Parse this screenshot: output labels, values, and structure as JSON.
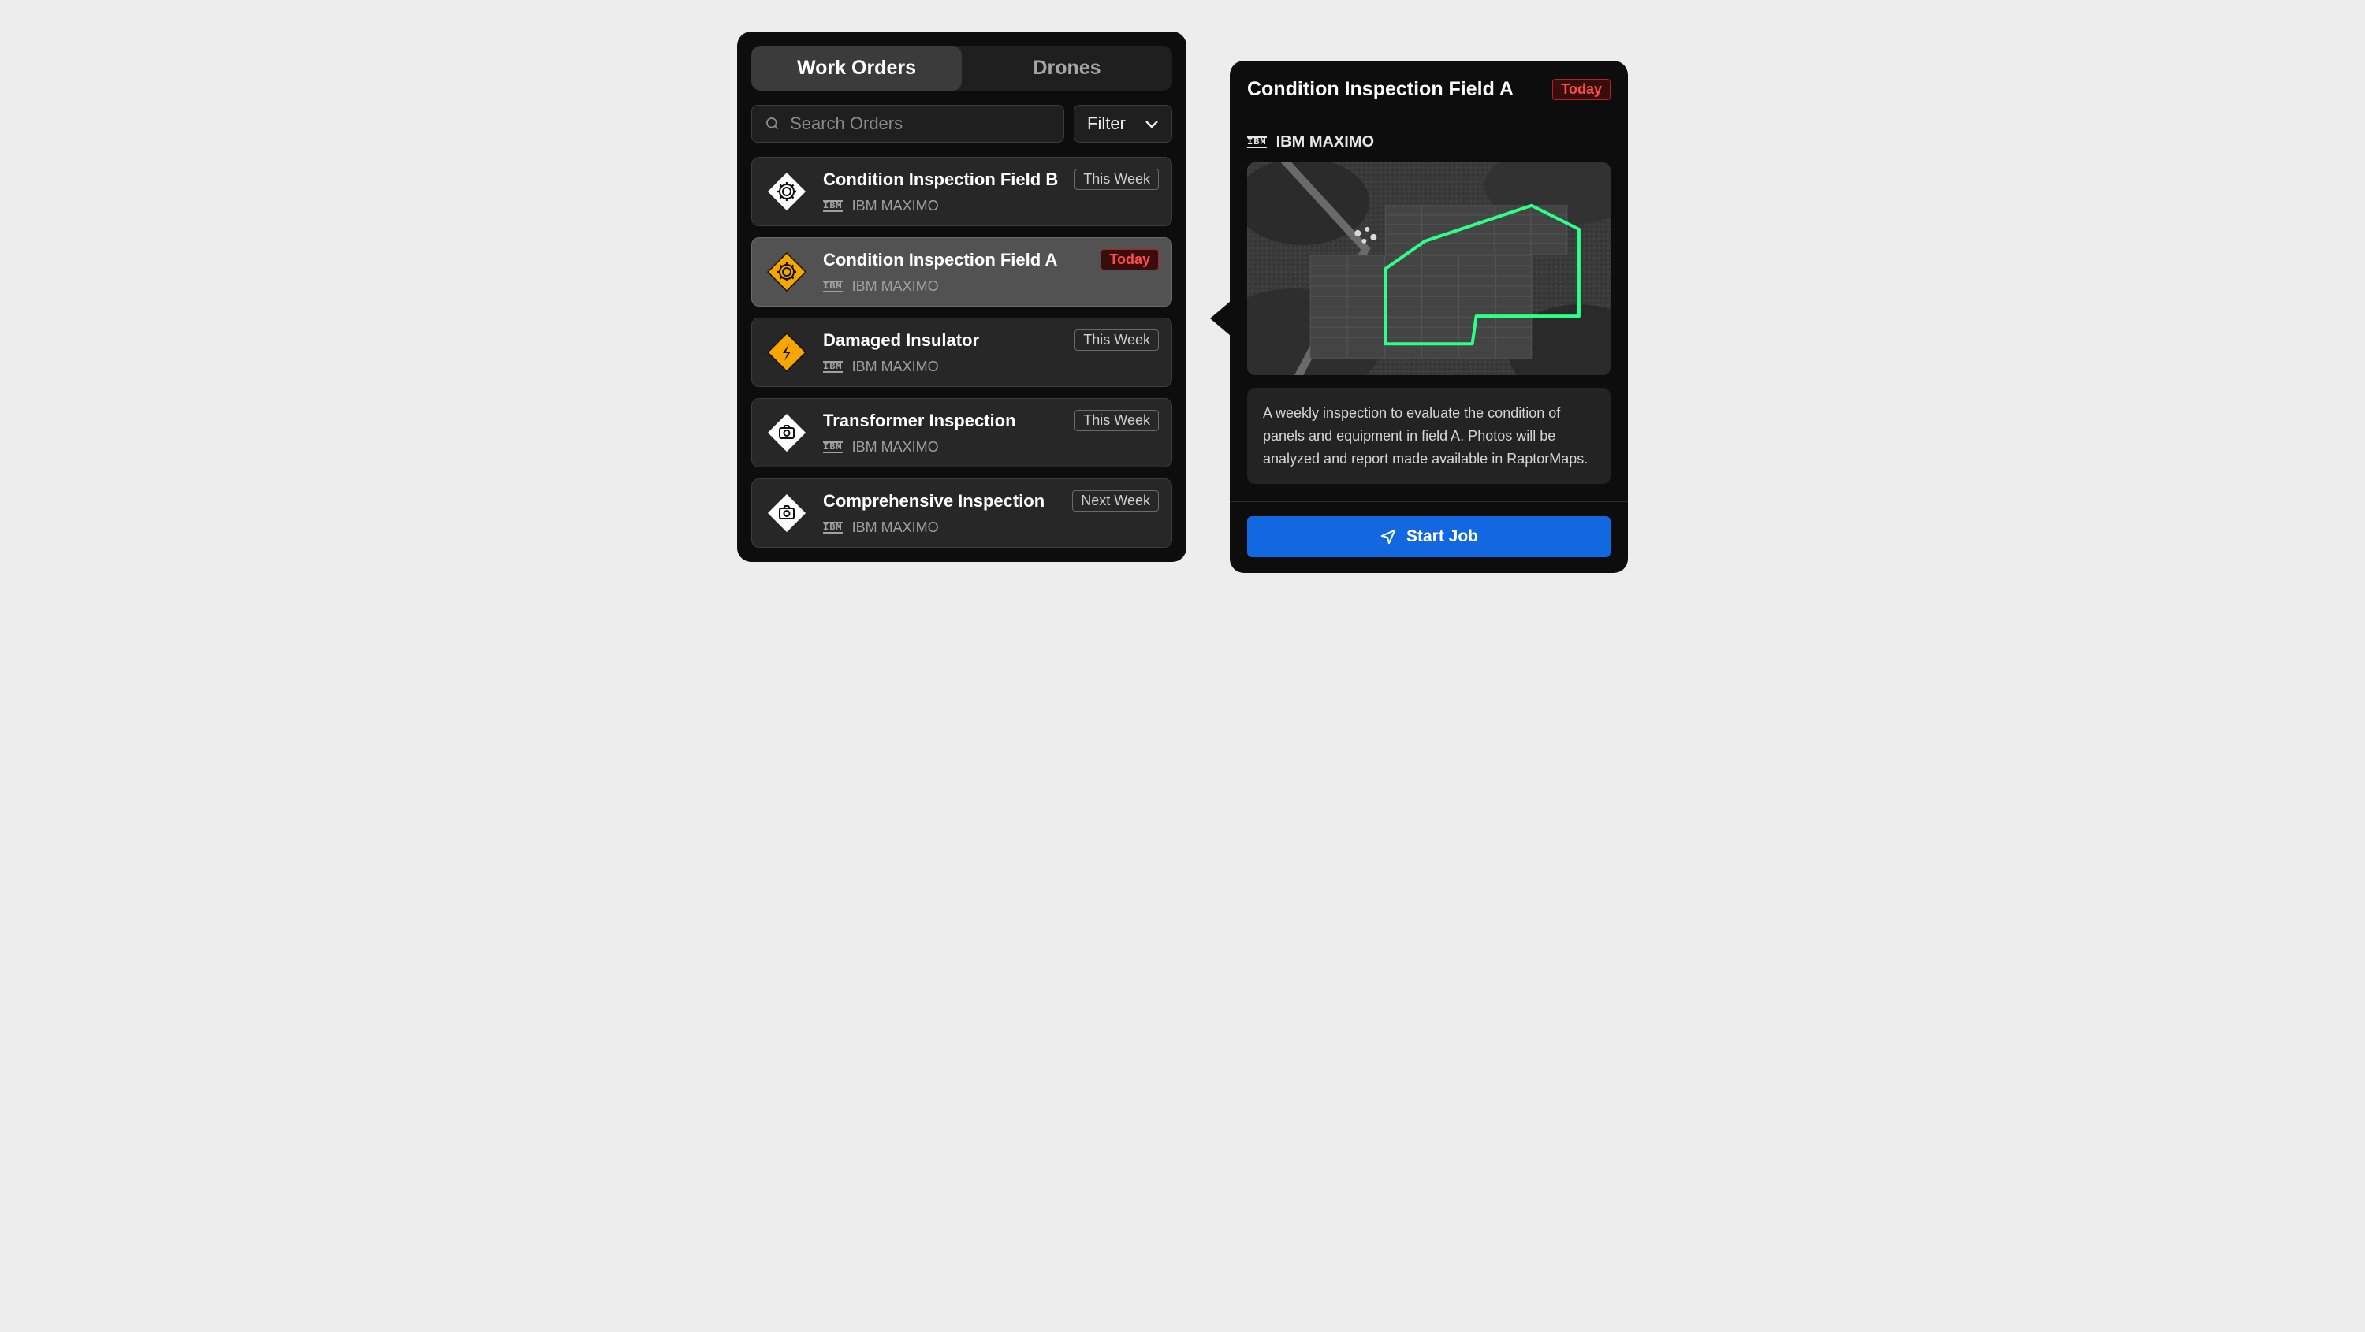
{
  "tabs": {
    "work_orders": "Work Orders",
    "drones": "Drones"
  },
  "search": {
    "placeholder": "Search Orders"
  },
  "filter": {
    "label": "Filter"
  },
  "orders": [
    {
      "title": "Condition Inspection Field B",
      "badge": "This Week",
      "badge_kind": "week",
      "source": "IBM MAXIMO",
      "icon": "gear-white"
    },
    {
      "title": "Condition Inspection Field A",
      "badge": "Today",
      "badge_kind": "today",
      "source": "IBM MAXIMO",
      "icon": "gear-yellow"
    },
    {
      "title": "Damaged Insulator",
      "badge": "This Week",
      "badge_kind": "week",
      "source": "IBM MAXIMO",
      "icon": "bolt-yellow"
    },
    {
      "title": "Transformer Inspection",
      "badge": "This Week",
      "badge_kind": "week",
      "source": "IBM MAXIMO",
      "icon": "camera-white"
    },
    {
      "title": "Comprehensive Inspection",
      "badge": "Next Week",
      "badge_kind": "week",
      "source": "IBM MAXIMO",
      "icon": "camera-white"
    }
  ],
  "detail": {
    "title": "Condition Inspection Field A",
    "badge": "Today",
    "source": "IBM MAXIMO",
    "description": "A weekly inspection to evaluate the condition of panels and equipment in field A. Photos will be analyzed and report made available in RaptorMaps.",
    "cta": "Start Job"
  },
  "colors": {
    "accent_blue": "#1268e0",
    "danger_red": "#ff4d4d",
    "map_outline": "#2dff88",
    "warn_yellow": "#f7a600"
  }
}
